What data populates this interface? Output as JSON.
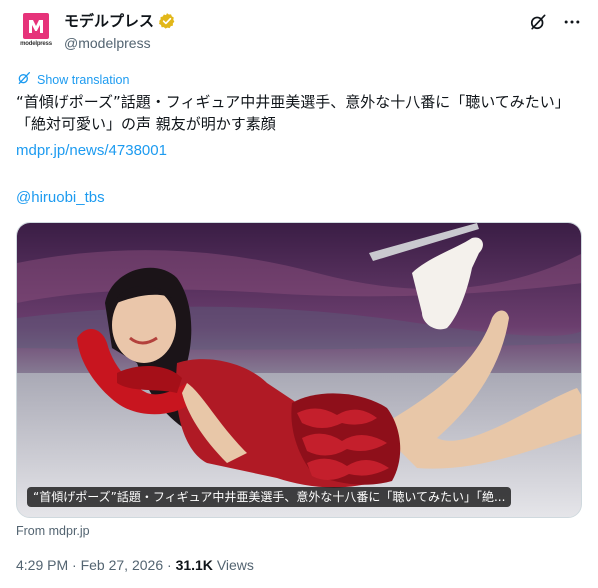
{
  "account": {
    "display_name": "モデルプレス",
    "handle": "@modelpress",
    "logo_sub": "modelpress",
    "brand_color": "#e6337a",
    "verified_color": "#e2b719"
  },
  "header_icons": [
    "grok-icon",
    "more-icon"
  ],
  "translate_label": "Show translation",
  "tweet": {
    "text": "“首傾げポーズ”話題・フィギュア中井亜美選手、意外な十八番に「聴いてみたい」「絶対可愛い」の声 親友が明かす素顔",
    "link": "mdpr.jp/news/4738001",
    "mention": "@hiruobi_tbs"
  },
  "media": {
    "caption": "“首傾げポーズ”話題・フィギュア中井亜美選手、意外な十八番に「聴いてみたい」「絶...",
    "source": "From mdpr.jp"
  },
  "meta": {
    "time": "4:29 PM",
    "date": "Feb 27, 2026",
    "views_count": "31.1K",
    "views_label": "Views"
  },
  "colors": {
    "link": "#1d9bf0",
    "secondary_text": "#536471"
  }
}
